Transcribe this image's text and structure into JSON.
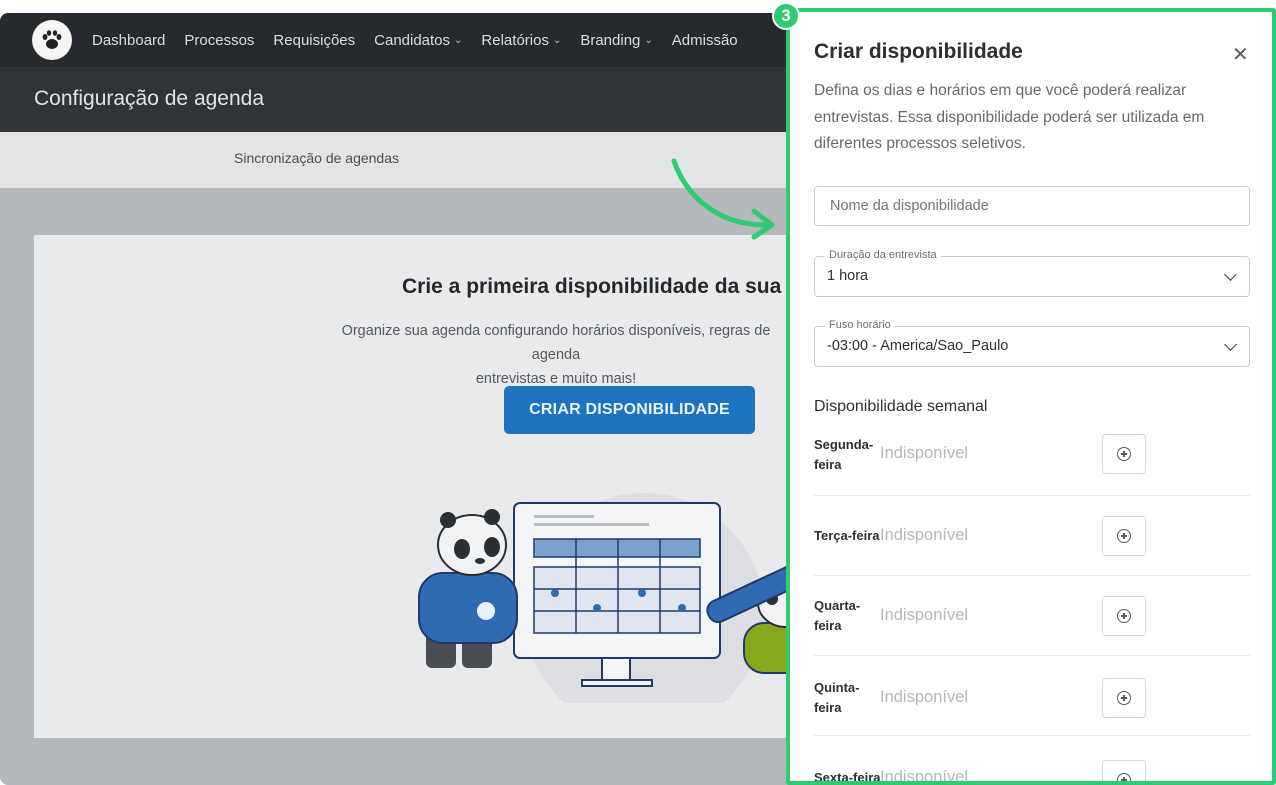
{
  "nav": {
    "items": [
      {
        "label": "Dashboard",
        "dropdown": false
      },
      {
        "label": "Processos",
        "dropdown": false
      },
      {
        "label": "Requisições",
        "dropdown": false
      },
      {
        "label": "Candidatos",
        "dropdown": true
      },
      {
        "label": "Relatórios",
        "dropdown": true
      },
      {
        "label": "Branding",
        "dropdown": true
      },
      {
        "label": "Admissão",
        "dropdown": false
      }
    ]
  },
  "page": {
    "title": "Configuração de agenda",
    "tab": "Sincronização de agendas"
  },
  "empty_state": {
    "heading": "Crie a primeira disponibilidade da sua a",
    "desc_line1": "Organize sua agenda configurando horários disponíveis, regras de agenda",
    "desc_line2": "entrevistas e muito mais!",
    "cta": "CRIAR DISPONIBILIDADE"
  },
  "callout": {
    "step": "3",
    "color": "#2ecc71"
  },
  "panel": {
    "title": "Criar disponibilidade",
    "close": "✕",
    "description": "Defina os dias e horários em que você poderá realizar entrevistas. Essa disponibilidade poderá ser utilizada em diferentes processos seletivos.",
    "name_placeholder": "Nome da disponibilidade",
    "duration": {
      "label": "Duração da entrevista",
      "value": "1 hora"
    },
    "timezone": {
      "label": "Fuso horário",
      "value": "-03:00 - America/Sao_Paulo"
    },
    "week_title": "Disponibilidade semanal",
    "days": [
      {
        "line1": "Segunda-",
        "line2": "feira",
        "status": "Indisponível"
      },
      {
        "line1": "Terça-feira",
        "line2": "",
        "status": "Indisponível"
      },
      {
        "line1": "Quarta-",
        "line2": "feira",
        "status": "Indisponível"
      },
      {
        "line1": "Quinta-",
        "line2": "feira",
        "status": "Indisponível"
      },
      {
        "line1": "Sexta-feira",
        "line2": "",
        "status": "Indisponível"
      }
    ]
  }
}
